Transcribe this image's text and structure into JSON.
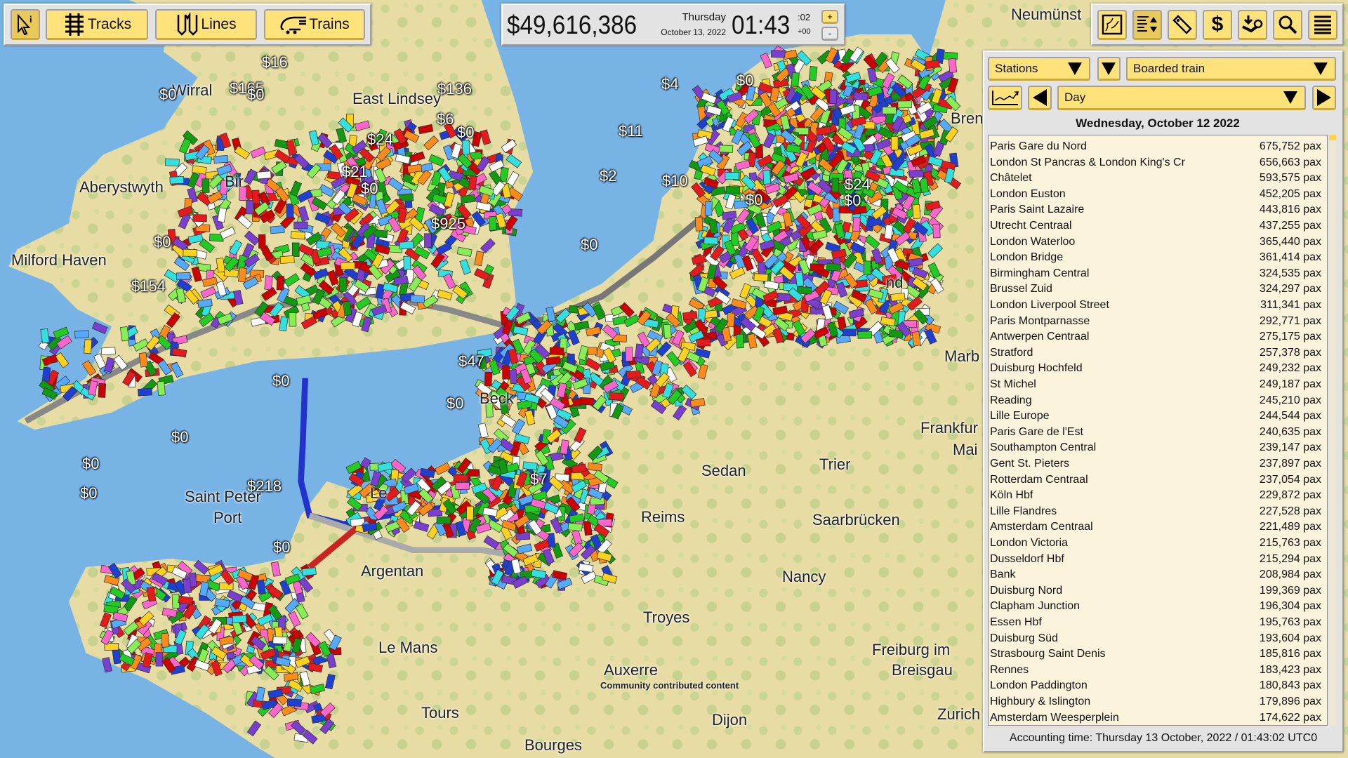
{
  "toolbar_left": {
    "info_icon": "pointer-info-icon",
    "tracks_label": "Tracks",
    "lines_label": "Lines",
    "trains_label": "Trains"
  },
  "clock": {
    "money": "$49,616,386",
    "weekday": "Thursday",
    "date": "October 13, 2022",
    "time": "01:43",
    "seconds": ":02",
    "offset": "+00",
    "speed_up": "+",
    "speed_down": "-"
  },
  "toolbar_right": {
    "icons": [
      "map-icon",
      "sort-list-icon",
      "price-tag-icon",
      "dollar-icon",
      "download-steam-icon",
      "search-icon",
      "menu-icon"
    ]
  },
  "panel": {
    "category": "Stations",
    "metric": "Boarded train",
    "period": "Day",
    "date_header": "Wednesday, October 12 2022",
    "stations": [
      {
        "name": "Paris Gare du Nord",
        "value": "675,752 pax"
      },
      {
        "name": "London St Pancras & London King's Cr",
        "value": "656,663 pax"
      },
      {
        "name": "Châtelet",
        "value": "593,575 pax"
      },
      {
        "name": "London Euston",
        "value": "452,205 pax"
      },
      {
        "name": "Paris Saint Lazaire",
        "value": "443,816 pax"
      },
      {
        "name": "Utrecht Centraal",
        "value": "437,255 pax"
      },
      {
        "name": "London Waterloo",
        "value": "365,440 pax"
      },
      {
        "name": "London Bridge",
        "value": "361,414 pax"
      },
      {
        "name": "Birmingham Central",
        "value": "324,535 pax"
      },
      {
        "name": "Brussel Zuid",
        "value": "324,297 pax"
      },
      {
        "name": "London Liverpool Street",
        "value": "311,341 pax"
      },
      {
        "name": "Paris Montparnasse",
        "value": "292,771 pax"
      },
      {
        "name": "Antwerpen Centraal",
        "value": "275,175 pax"
      },
      {
        "name": "Stratford",
        "value": "257,378 pax"
      },
      {
        "name": "Duisburg Hochfeld",
        "value": "249,232 pax"
      },
      {
        "name": "St Michel",
        "value": "249,187 pax"
      },
      {
        "name": "Reading",
        "value": "245,210 pax"
      },
      {
        "name": "Lille Europe",
        "value": "244,544 pax"
      },
      {
        "name": "Paris Gare de l'Est",
        "value": "240,635 pax"
      },
      {
        "name": "Southampton Central",
        "value": "239,147 pax"
      },
      {
        "name": "Gent St. Pieters",
        "value": "237,897 pax"
      },
      {
        "name": "Rotterdam Centraal",
        "value": "237,054 pax"
      },
      {
        "name": "Köln Hbf",
        "value": "229,872 pax"
      },
      {
        "name": "Lille Flandres",
        "value": "227,528 pax"
      },
      {
        "name": "Amsterdam Centraal",
        "value": "221,489 pax"
      },
      {
        "name": "London Victoria",
        "value": "215,763 pax"
      },
      {
        "name": "Dusseldorf Hbf",
        "value": "215,294 pax"
      },
      {
        "name": "Bank",
        "value": "208,984 pax"
      },
      {
        "name": "Duisburg Nord",
        "value": "199,369 pax"
      },
      {
        "name": "Clapham Junction",
        "value": "196,304 pax"
      },
      {
        "name": "Essen Hbf",
        "value": "195,763 pax"
      },
      {
        "name": "Duisburg Süd",
        "value": "193,604 pax"
      },
      {
        "name": "Strasbourg Saint Denis",
        "value": "185,816 pax"
      },
      {
        "name": "Rennes",
        "value": "183,423 pax"
      },
      {
        "name": "London Paddington",
        "value": "180,843 pax"
      },
      {
        "name": "Highbury & Islington",
        "value": "179,896 pax"
      },
      {
        "name": "Amsterdam Weesperplein",
        "value": "174,622 pax"
      }
    ],
    "footer": "Accounting time: Thursday 13 October, 2022 / 01:43:02 UTC0"
  },
  "map": {
    "places": [
      "Neumünst",
      "Wirral",
      "East Lindsey",
      "Aberystwyth",
      "Milford Haven",
      "Saint Peter",
      "Port",
      "Argentan",
      "Le Mans",
      "Tours",
      "Bourges",
      "Auxerre",
      "Dijon",
      "Troyes",
      "Reims",
      "Sedan",
      "Trier",
      "Saarbrücken",
      "Nancy",
      "Freiburg im",
      "Breisgau",
      "Frankfur",
      "Mai",
      "Marb",
      "Bren",
      "Zurich",
      "Bir",
      "Le",
      "Beck",
      "nd"
    ],
    "revenue_labels": [
      "$16",
      "$165",
      "$0",
      "$0",
      "$136",
      "$6",
      "$0",
      "$4",
      "$0",
      "$11",
      "$2",
      "$0",
      "$0",
      "$154",
      "$47",
      "$0",
      "$0",
      "$0",
      "$0",
      "$218",
      "$0",
      "$0",
      "$925",
      "$24",
      "$21",
      "$0",
      "$0",
      "$10",
      "$0",
      "$24",
      "$7"
    ],
    "attribution": "Community contributed content",
    "colors": {
      "sea": "#78b3e6",
      "land": "#e6dca4",
      "panel": "#e3e3e3",
      "button": "#ffe27a",
      "list": "#fbf3dc"
    }
  }
}
